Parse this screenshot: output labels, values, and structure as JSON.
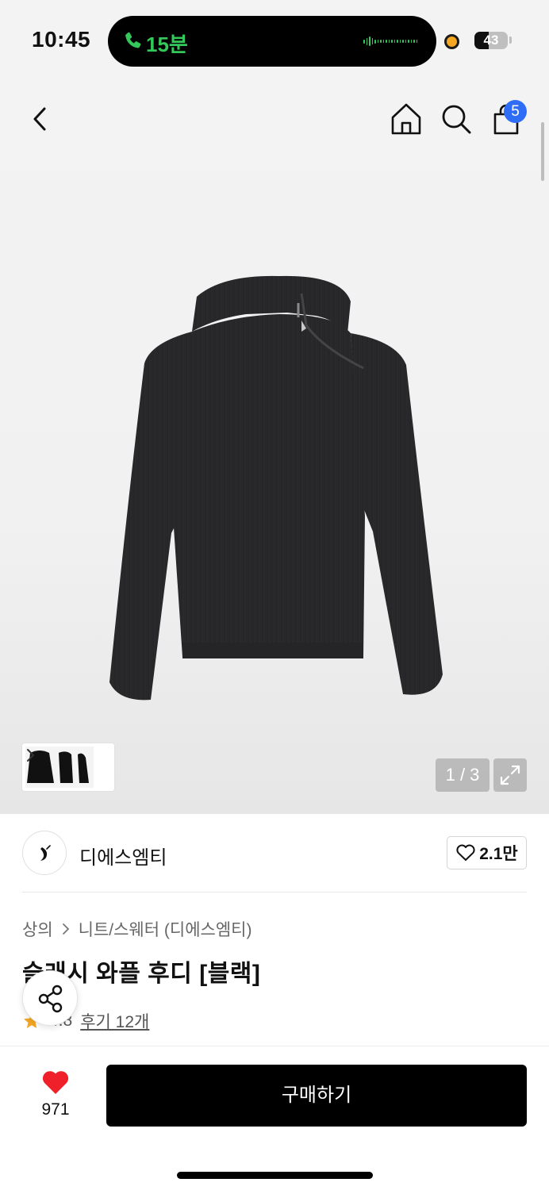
{
  "status_bar": {
    "time": "10:45",
    "call_label": "15분",
    "battery_level": "43",
    "battery_fraction": 0.43,
    "accent_green": "#34c759"
  },
  "header": {
    "icons": [
      "back-icon",
      "home-icon",
      "search-icon",
      "cart-icon"
    ],
    "cart_badge": "5",
    "badge_color": "#2f6df6"
  },
  "gallery": {
    "counter": "1 / 3",
    "current": 1,
    "total": 3,
    "expand_icon": "expand-icon"
  },
  "brand": {
    "name": "디에스엠티",
    "like_count": "2.1만"
  },
  "product": {
    "breadcrumb": [
      "상의",
      "니트/스웨터 (디에스엠티)"
    ],
    "title": "슬래시 와플 후디 [블랙]",
    "rating": "4.8",
    "reviews": "후기 12개"
  },
  "purchase_bar": {
    "wish_count": "971",
    "buy_label": "구매하기",
    "heart_color": "#f0202a"
  }
}
